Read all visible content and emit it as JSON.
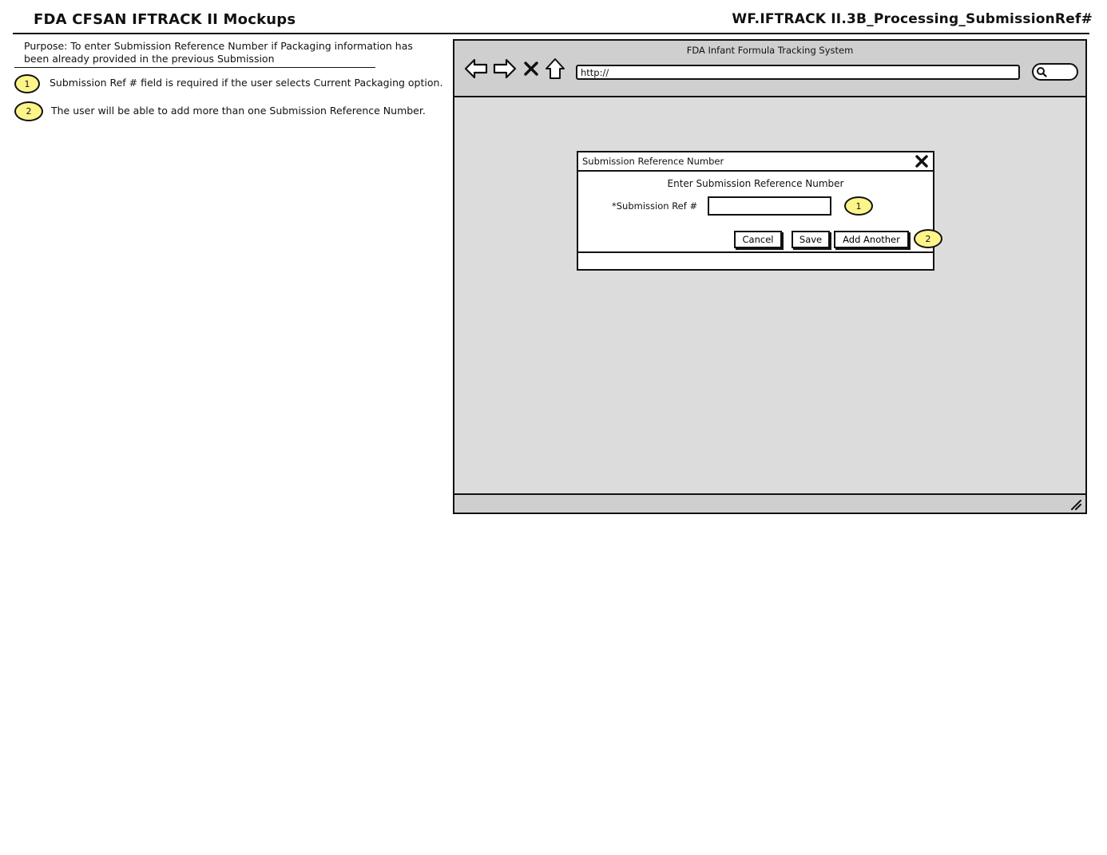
{
  "header": {
    "title": "FDA CFSAN IFTRACK II Mockups",
    "doc_id": "WF.IFTRACK II.3B_Processing_SubmissionRef#"
  },
  "annotations": {
    "purpose": "Purpose: To enter Submission Reference Number if Packaging information has been already provided in the previous Submission",
    "notes": [
      {
        "badge": "1",
        "text": "Submission Ref # field is required if the user selects Current Packaging option."
      },
      {
        "badge": "2",
        "text": "The user will be able to add more than one Submission Reference Number."
      }
    ]
  },
  "browser": {
    "window_title": "FDA Infant Formula Tracking System",
    "url": "http://"
  },
  "dialog": {
    "title": "Submission Reference Number",
    "heading": "Enter Submission Reference Number",
    "field_label": "*Submission Ref #",
    "field_value": "",
    "callout_field": "1",
    "callout_buttons": "2",
    "buttons": {
      "cancel": "Cancel",
      "save": "Save",
      "add_another": "Add Another"
    }
  },
  "colors": {
    "callout_fill": "#fef58a",
    "chrome": "#cfcfcf",
    "content": "#dcdcdc"
  }
}
